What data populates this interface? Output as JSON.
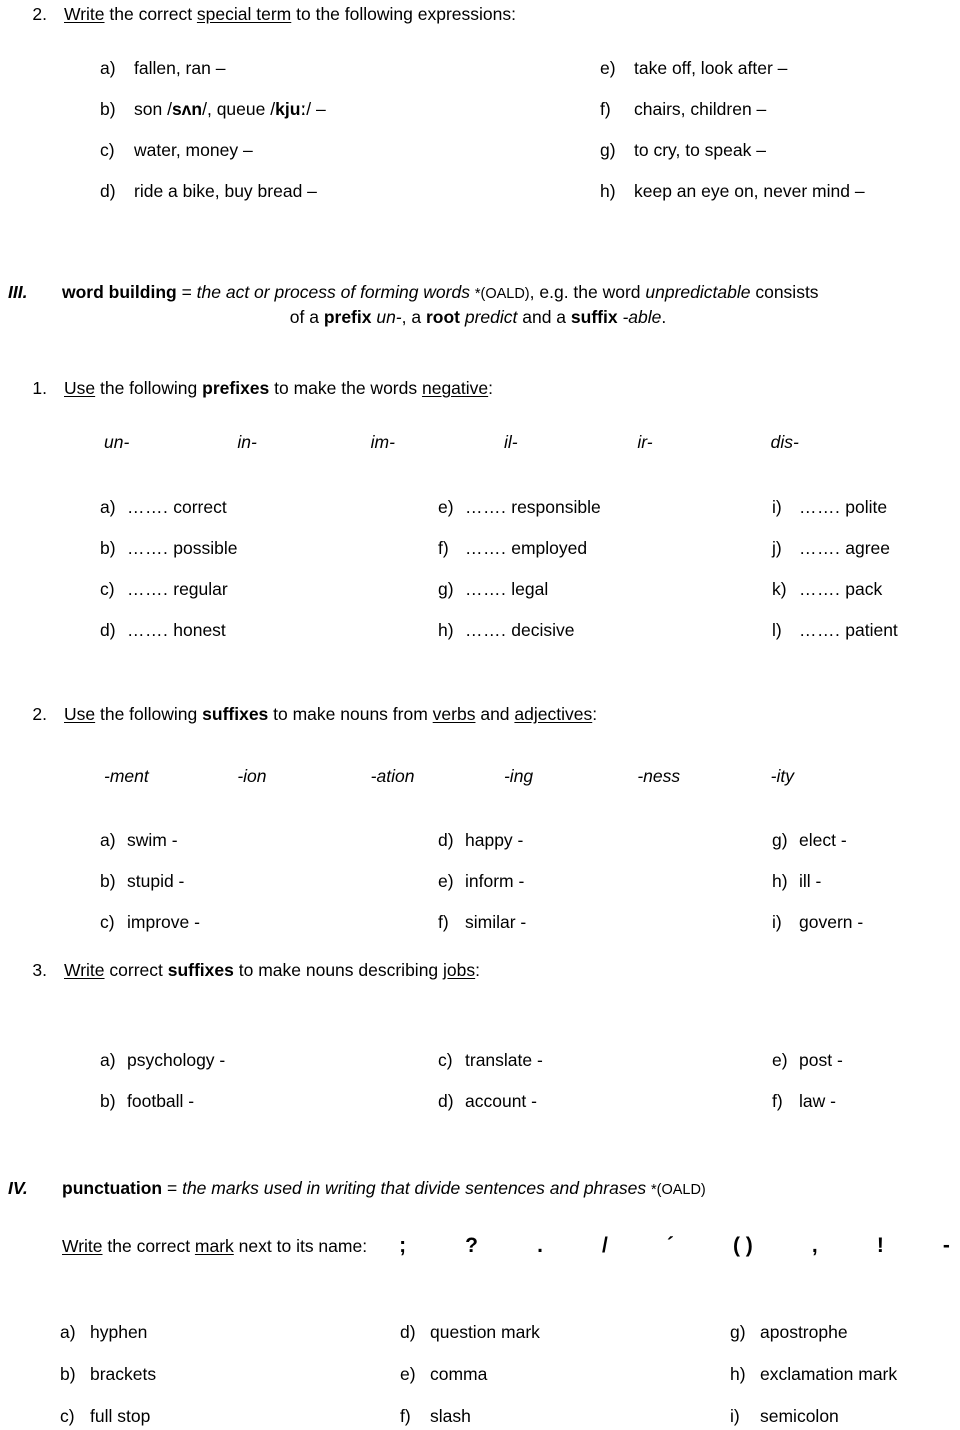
{
  "section_2": {
    "number": "2.",
    "prompt_parts": {
      "verb": "Write",
      "mid": " the correct ",
      "term": "special term",
      "end": " to the following expressions:"
    },
    "items": [
      {
        "label": "a)",
        "text": "fallen, ran –"
      },
      {
        "label": "e)",
        "text": "take off, look after –"
      },
      {
        "label": "b)",
        "text_pre": "son /",
        "ipa1": "sʌn",
        "text_mid": "/, queue /",
        "ipa2": "kjuː",
        "text_post": "/ –"
      },
      {
        "label": "f)",
        "text": "chairs, children –"
      },
      {
        "label": "c)",
        "text": "water, money –"
      },
      {
        "label": "g)",
        "text": "to cry, to speak  –"
      },
      {
        "label": "d)",
        "text": "ride a bike, buy bread –"
      },
      {
        "label": "h)",
        "text": "keep an eye on, never mind –"
      }
    ]
  },
  "section_3": {
    "roman": "III.",
    "term": "word building",
    "equals": " = ",
    "definition": "the act or process of forming words",
    "source": "*(OALD)",
    "after_source": ", e.g. the word ",
    "example_word": "unpredictable",
    "after_example": " consists",
    "line2_pre": "of a ",
    "line2_prefix_label": "prefix",
    "line2_prefix_val": " un-",
    "line2_mid": ", a ",
    "line2_root_label": "root",
    "line2_root_val": " predict",
    "line2_and": " and a ",
    "line2_suffix_label": "suffix",
    "line2_suffix_val": " -able",
    "line2_end": "."
  },
  "exercise_1": {
    "number": "1.",
    "prompt": {
      "verb": "Use",
      "mid": " the following ",
      "bold": "prefixes",
      "mid2": " to make the words ",
      "underlined": "negative",
      "end": ":"
    },
    "prefixes": [
      "un-",
      "in-",
      "im-",
      "il-",
      "ir-",
      "dis-"
    ],
    "blank": "…….",
    "items": [
      {
        "label": "a)",
        "word": "correct"
      },
      {
        "label": "e)",
        "word": "responsible"
      },
      {
        "label": "i)",
        "word": "polite"
      },
      {
        "label": "b)",
        "word": "possible"
      },
      {
        "label": "f)",
        "word": "employed"
      },
      {
        "label": "j)",
        "word": "agree"
      },
      {
        "label": "c)",
        "word": "regular"
      },
      {
        "label": "g)",
        "word": "legal"
      },
      {
        "label": "k)",
        "word": "pack"
      },
      {
        "label": "d)",
        "word": "honest"
      },
      {
        "label": "h)",
        "word": "decisive"
      },
      {
        "label": "l)",
        "word": "patient"
      }
    ]
  },
  "exercise_2": {
    "number": "2.",
    "prompt": {
      "verb": "Use",
      "mid": " the following ",
      "bold": "suffixes",
      "mid2": " to make nouns from ",
      "u1": "verbs",
      "mid3": " and ",
      "u2": "adjectives",
      "end": ":"
    },
    "suffixes": [
      "-ment",
      "-ion",
      "-ation",
      "-ing",
      "-ness",
      "-ity"
    ],
    "items": [
      {
        "label": "a)",
        "word": "swim -"
      },
      {
        "label": "d)",
        "word": "happy -"
      },
      {
        "label": "g)",
        "word": "elect -"
      },
      {
        "label": "b)",
        "word": "stupid -"
      },
      {
        "label": "e)",
        "word": "inform -"
      },
      {
        "label": "h)",
        "word": "ill -"
      },
      {
        "label": "c)",
        "word": "improve -"
      },
      {
        "label": "f)",
        "word": "similar -"
      },
      {
        "label": "i)",
        "word": "govern -"
      }
    ]
  },
  "exercise_3": {
    "number": "3.",
    "prompt": {
      "verb": "Write",
      "mid": " correct ",
      "bold": "suffixes",
      "mid2": " to make nouns describing ",
      "underlined": "jobs",
      "end": ":"
    },
    "items": [
      {
        "label": "a)",
        "word": "psychology -"
      },
      {
        "label": "c)",
        "word": "translate -"
      },
      {
        "label": "e)",
        "word": "post -"
      },
      {
        "label": "b)",
        "word": "football -"
      },
      {
        "label": "d)",
        "word": "account -"
      },
      {
        "label": "f)",
        "word": "law -"
      }
    ]
  },
  "section_4": {
    "roman": "IV.",
    "term": "punctuation",
    "equals": " = ",
    "definition": "the marks used in writing that divide sentences and phrases",
    "source": "*(OALD)",
    "prompt": {
      "verb": "Write",
      "mid": " the correct ",
      "underlined": "mark",
      "end": " next to its name:"
    },
    "marks": [
      ";",
      "?",
      ".",
      "/",
      "´",
      "( )",
      ",",
      "!",
      "-"
    ],
    "items": [
      {
        "label": "a)",
        "name": "hyphen"
      },
      {
        "label": "d)",
        "name": "question mark"
      },
      {
        "label": "g)",
        "name": "apostrophe"
      },
      {
        "label": "b)",
        "name": "brackets"
      },
      {
        "label": "e)",
        "name": "comma"
      },
      {
        "label": "h)",
        "name": "exclamation mark"
      },
      {
        "label": "c)",
        "name": "full stop"
      },
      {
        "label": "f)",
        "name": "slash"
      },
      {
        "label": "i)",
        "name": "semicolon"
      }
    ]
  }
}
